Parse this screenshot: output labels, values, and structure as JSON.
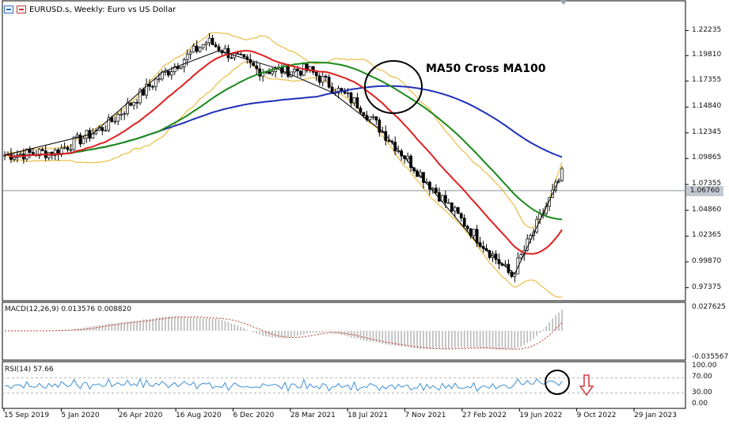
{
  "header": {
    "symbol_title": "EURUSD.s, Weekly:  Euro vs US Dollar"
  },
  "annotation": "MA50 Cross MA100",
  "current_price_label": "1.06760",
  "macd_header": "MACD(12,26,9) 0.013576 0.008820",
  "rsi_header": "RSI(14) 57.66",
  "price_axis": [
    "1.22235",
    "1.19810",
    "1.17355",
    "1.14840",
    "1.12345",
    "1.09865",
    "1.07355",
    "1.04860",
    "1.02365",
    "0.99870",
    "0.97375"
  ],
  "macd_axis": [
    "0.027625",
    "-0.035567"
  ],
  "rsi_axis": [
    "100.00",
    "70.00",
    "30.00",
    "0.00"
  ],
  "time_axis": [
    "15 Sep 2019",
    "5 Jan 2020",
    "26 Apr 2020",
    "16 Aug 2020",
    "6 Dec 2020",
    "28 Mar 2021",
    "18 Jul 2021",
    "7 Nov 2021",
    "27 Feb 2022",
    "19 Jun 2022",
    "9 Oct 2022",
    "29 Jan 2023"
  ],
  "colors": {
    "ma_fast": "#e02020",
    "ma50": "#1a8a1a",
    "ma100": "#1f2fb8",
    "bands": "#e8b020",
    "zigzag": "#000000",
    "macd_hist": "#b8b8b8",
    "macd_signal": "#c0392b",
    "rsi_line": "#3d8fd6",
    "arrow": "#d63a3a"
  },
  "chart_data": [
    {
      "type": "line",
      "title": "EURUSD.s, Weekly:  Euro vs US Dollar",
      "x": [
        "15 Sep 2019",
        "5 Jan 2020",
        "26 Apr 2020",
        "16 Aug 2020",
        "6 Dec 2020",
        "28 Mar 2021",
        "18 Jul 2021",
        "7 Nov 2021",
        "27 Feb 2022",
        "19 Jun 2022",
        "9 Oct 2022",
        "29 Jan 2023"
      ],
      "series": [
        {
          "values": [
            1.102,
            1.105,
            1.13,
            1.175,
            1.212,
            1.184,
            1.184,
            1.15,
            1.095,
            1.04,
            0.985,
            1.083
          ]
        }
      ],
      "ylim": [
        0.965,
        1.235
      ],
      "annotations": [
        "MA50 Cross MA100"
      ],
      "current": 1.0676
    },
    {
      "type": "bar",
      "title": "MACD(12,26,9) 0.013576 0.008820",
      "ylim": [
        -0.035567,
        0.027625
      ]
    },
    {
      "type": "line",
      "title": "RSI(14) 57.66",
      "ylim": [
        0,
        100
      ],
      "levels": [
        70,
        30
      ]
    }
  ]
}
